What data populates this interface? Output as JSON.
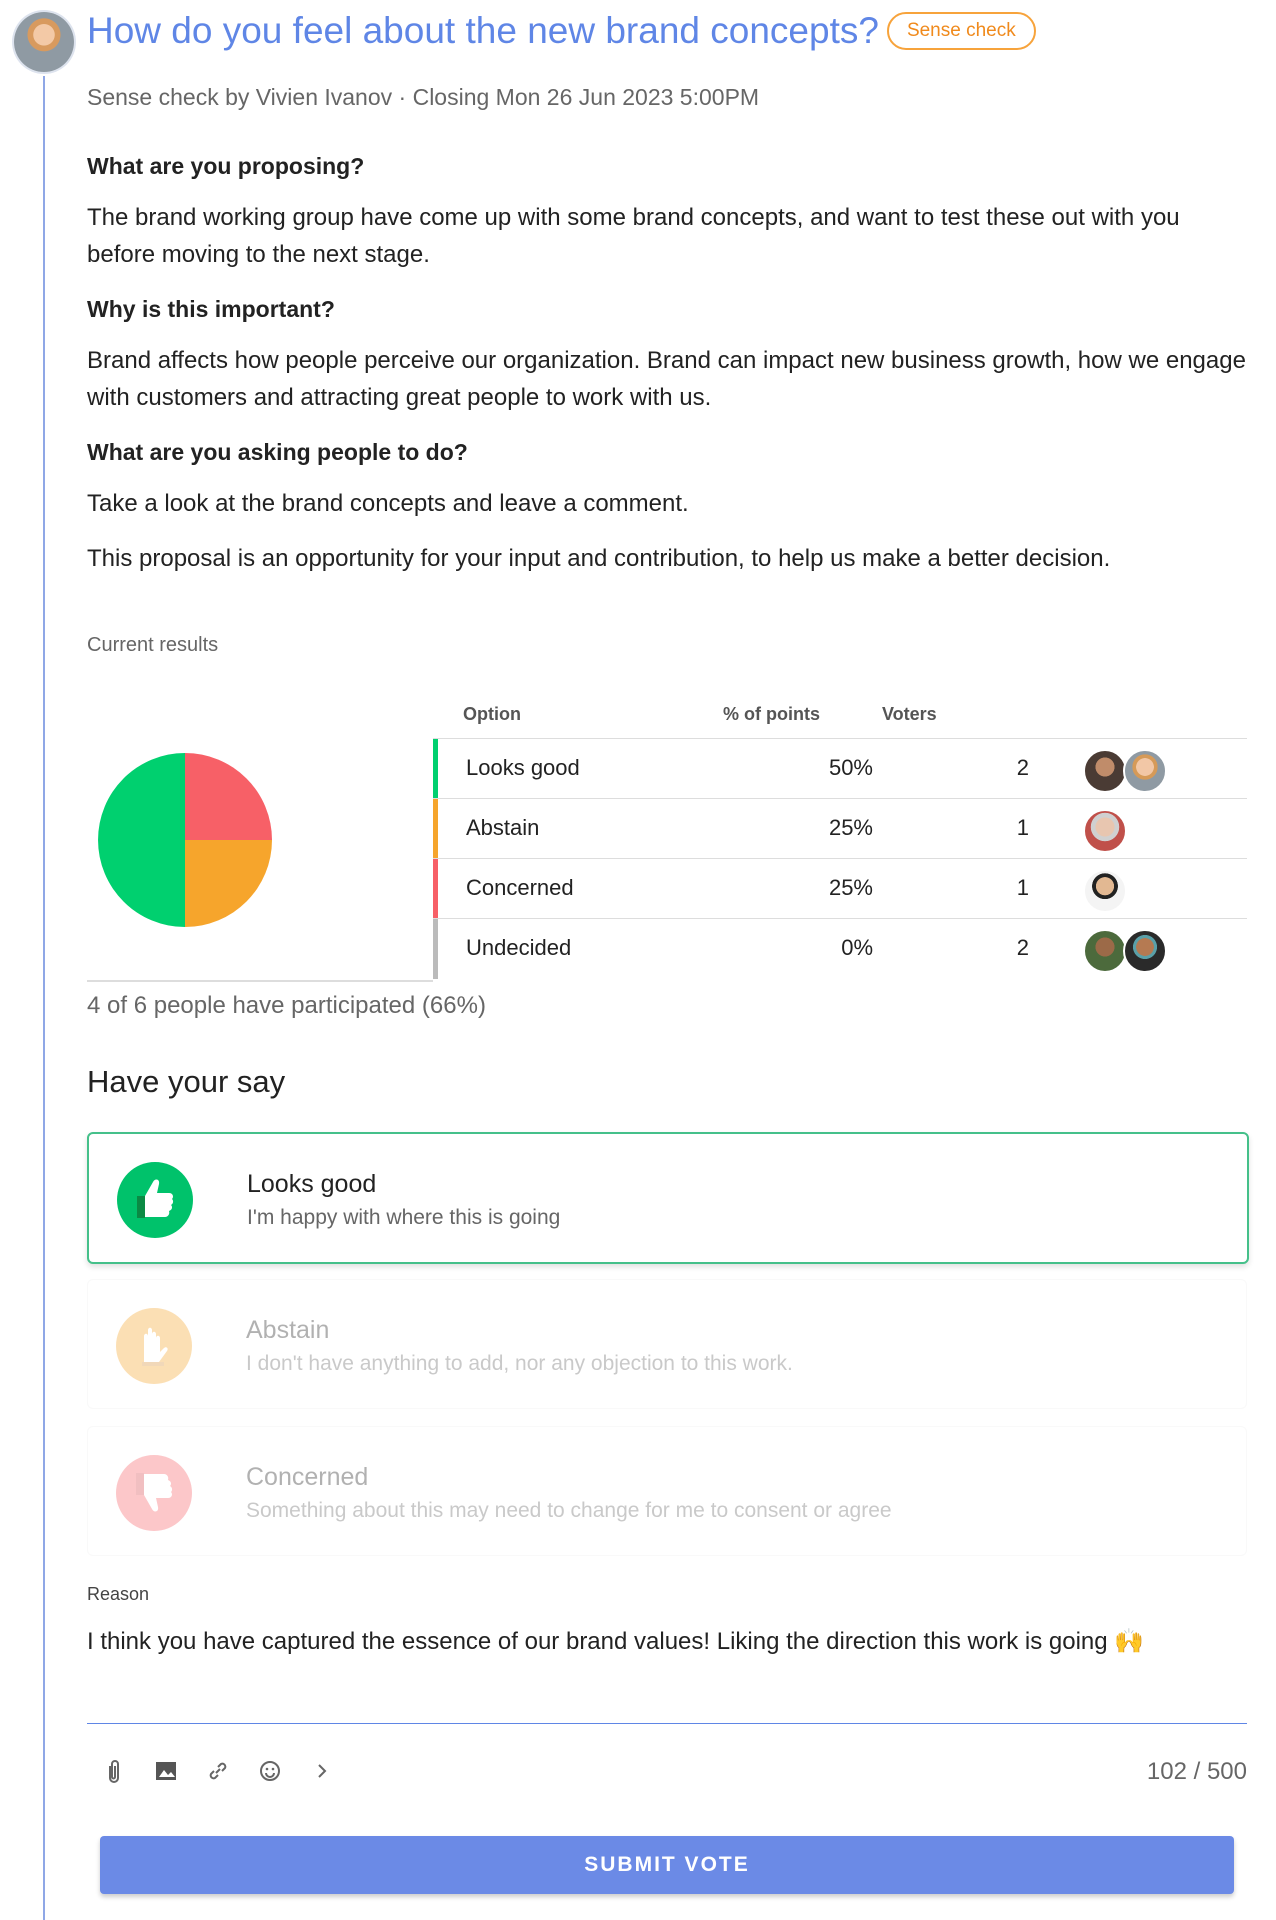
{
  "header": {
    "title": "How do you feel about the new brand concepts?",
    "badge": "Sense check",
    "meta": "Sense check by Vivien Ivanov · Closing Mon 26 Jun 2023 5:00PM"
  },
  "body": {
    "q1": "What are you proposing?",
    "a1": "The brand working group have come up with some brand concepts, and want to test these out with you before moving to the next stage.",
    "q2": "Why is this important?",
    "a2": "Brand affects how people perceive our organization. Brand can impact new business growth, how we engage with customers and attracting great people to work with us.",
    "q3": "What are you asking people to do?",
    "a3": "Take a look at the brand concepts and leave a comment.",
    "a4": "This proposal is an opportunity for your input and contribution, to help us make a better decision."
  },
  "results": {
    "label": "Current results",
    "headers": {
      "option": "Option",
      "points": "% of points",
      "voters": "Voters"
    },
    "rows": [
      {
        "option": "Looks good",
        "points": "50%",
        "voters": "2",
        "color": "#00d06f"
      },
      {
        "option": "Abstain",
        "points": "25%",
        "voters": "1",
        "color": "#f6a52c"
      },
      {
        "option": "Concerned",
        "points": "25%",
        "voters": "1",
        "color": "#f76067"
      },
      {
        "option": "Undecided",
        "points": "0%",
        "voters": "2",
        "color": "#bbbbbb"
      }
    ],
    "participation": "4 of 6 people have participated (66%)"
  },
  "chart_data": {
    "type": "pie",
    "categories": [
      "Looks good",
      "Abstain",
      "Concerned"
    ],
    "values": [
      50,
      25,
      25
    ],
    "colors": [
      "#00d06f",
      "#f6a52c",
      "#f76067"
    ]
  },
  "vote": {
    "title": "Have your say",
    "options": [
      {
        "title": "Looks good",
        "desc": "I'm happy with where this is going",
        "icon": "thumbs-up-icon",
        "color": "#00c26b"
      },
      {
        "title": "Abstain",
        "desc": "I don't have anything to add, nor any objection to this work.",
        "icon": "hand-stop-icon",
        "color": "#f6a52c"
      },
      {
        "title": "Concerned",
        "desc": "Something about this may need to change for me to consent or agree",
        "icon": "thumbs-down-icon",
        "color": "#f76067"
      }
    ],
    "reason_label": "Reason",
    "reason_text": "I think you have captured the essence of our brand values!  Liking the direction this work is going 🙌",
    "counter": "102 / 500",
    "submit": "SUBMIT VOTE"
  }
}
